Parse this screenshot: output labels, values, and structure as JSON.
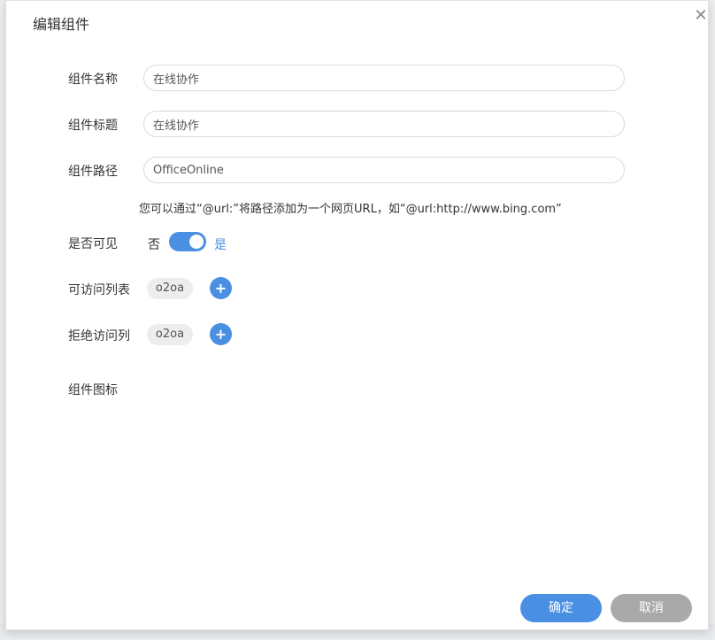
{
  "dialog": {
    "title": "编辑组件",
    "close_icon": "close-icon"
  },
  "form": {
    "name_label": "组件名称",
    "name_value": "在线协作",
    "title_label": "组件标题",
    "title_value": "在线协作",
    "path_label": "组件路径",
    "path_value": "OfficeOnline",
    "path_hint": "您可以通过“@url:”将路径添加为一个网页URL，如“@url:http://www.bing.com”",
    "visible_label": "是否可见",
    "visible_off": "否",
    "visible_on": "是",
    "allow_label": "可访问列表",
    "allow_tag": "o2oa",
    "deny_label": "拒绝访问列",
    "deny_tag": "o2oa",
    "icon_label": "组件图标"
  },
  "buttons": {
    "ok": "确定",
    "cancel": "取消"
  },
  "colors": {
    "accent": "#4a90e2",
    "cancel": "#a9a9a9"
  }
}
